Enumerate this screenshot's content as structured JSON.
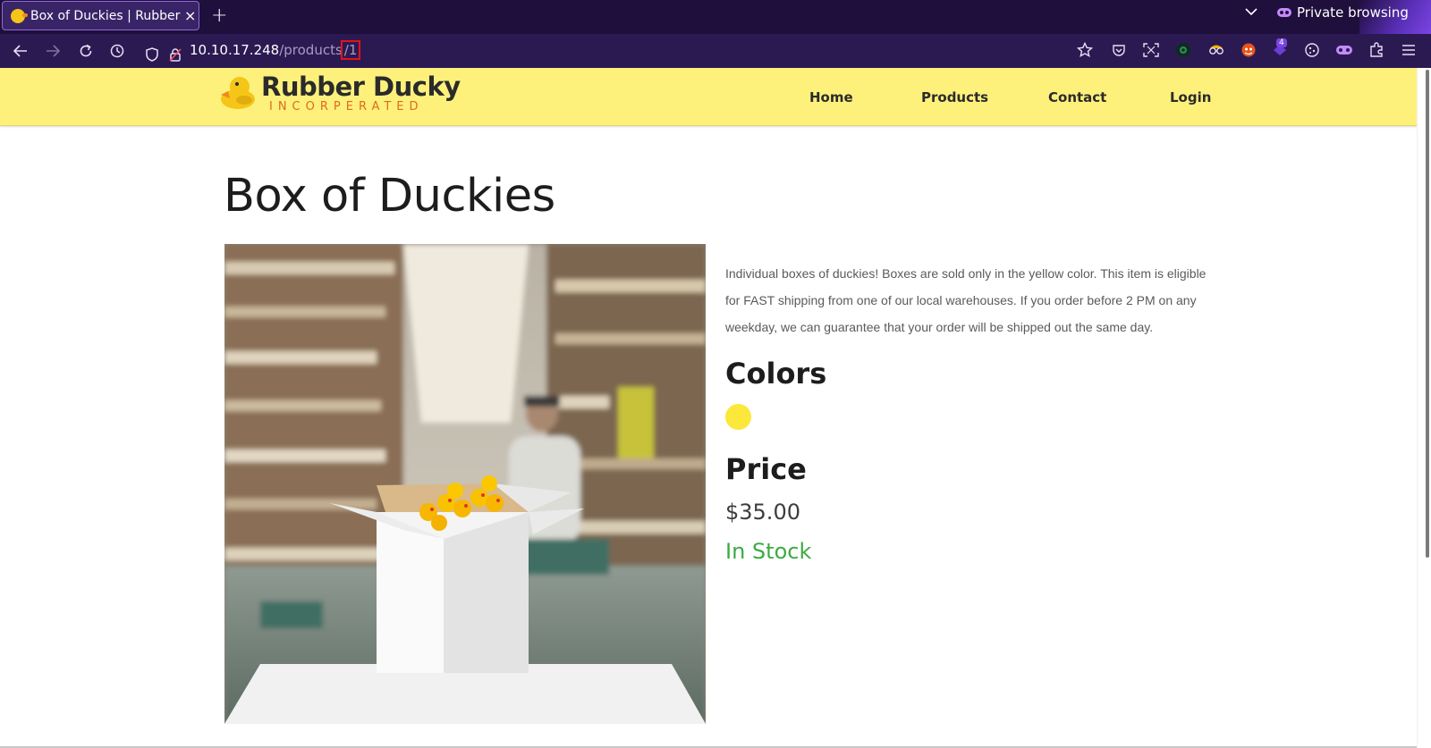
{
  "browser": {
    "tab_title": "Box of Duckies | Rubber Ducky Incorperated",
    "tab_close": "×",
    "new_tab": "+",
    "private_label": "Private browsing",
    "url_host": "10.10.17.248",
    "url_path": "/products",
    "url_highlight": "/1",
    "extension_badge": "4",
    "accent_color": "#2b1a52",
    "highlight_color": "#e0131a"
  },
  "site": {
    "logo_title": "Rubber Ducky",
    "logo_subtitle": "INCORPERATED",
    "nav": [
      {
        "label": "Home"
      },
      {
        "label": "Products"
      },
      {
        "label": "Contact"
      },
      {
        "label": "Login"
      }
    ],
    "header_color": "#fdf17b"
  },
  "product": {
    "title": "Box of Duckies",
    "description": "Individual boxes of duckies! Boxes are sold only in the yellow color. This item is eligible for FAST shipping from one of our local warehouses. If you order before 2 PM on any weekday, we can guarantee that your order will be shipped out the same day.",
    "colors_heading": "Colors",
    "colors": [
      {
        "name": "yellow",
        "hex": "#fbe83a"
      }
    ],
    "price_heading": "Price",
    "price": "$35.00",
    "stock_status": "In Stock",
    "stock_color": "#3caa43"
  }
}
